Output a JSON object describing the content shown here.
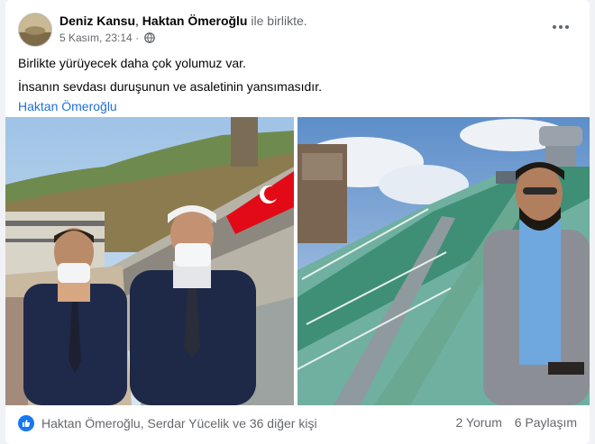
{
  "post": {
    "author": "Deniz Kansu",
    "separator": ",",
    "tagged": "Haktan Ömeroğlu",
    "with_text": "ile birlikte.",
    "timestamp": "5 Kasım, 23:14",
    "dot": "·",
    "privacy_icon": "globe-icon",
    "more_icon": "more-options-icon",
    "text_lines": [
      "Birlikte yürüyecek daha çok yolumuz var.",
      "İnsanın sevdası duruşunun ve asaletinin yansımasıdır."
    ],
    "mention": "Haktan Ömeroğlu"
  },
  "reactions": {
    "icon": "like-icon",
    "summary": "Haktan Ömeroğlu, Serdar Yücelik ve 36 diğer kişi"
  },
  "stats": {
    "comments": "2 Yorum",
    "shares": "6 Paylaşım"
  },
  "colors": {
    "link": "#216fdb",
    "like": "#1877f2",
    "muted": "#65676b",
    "flag_red": "#e30a17"
  }
}
